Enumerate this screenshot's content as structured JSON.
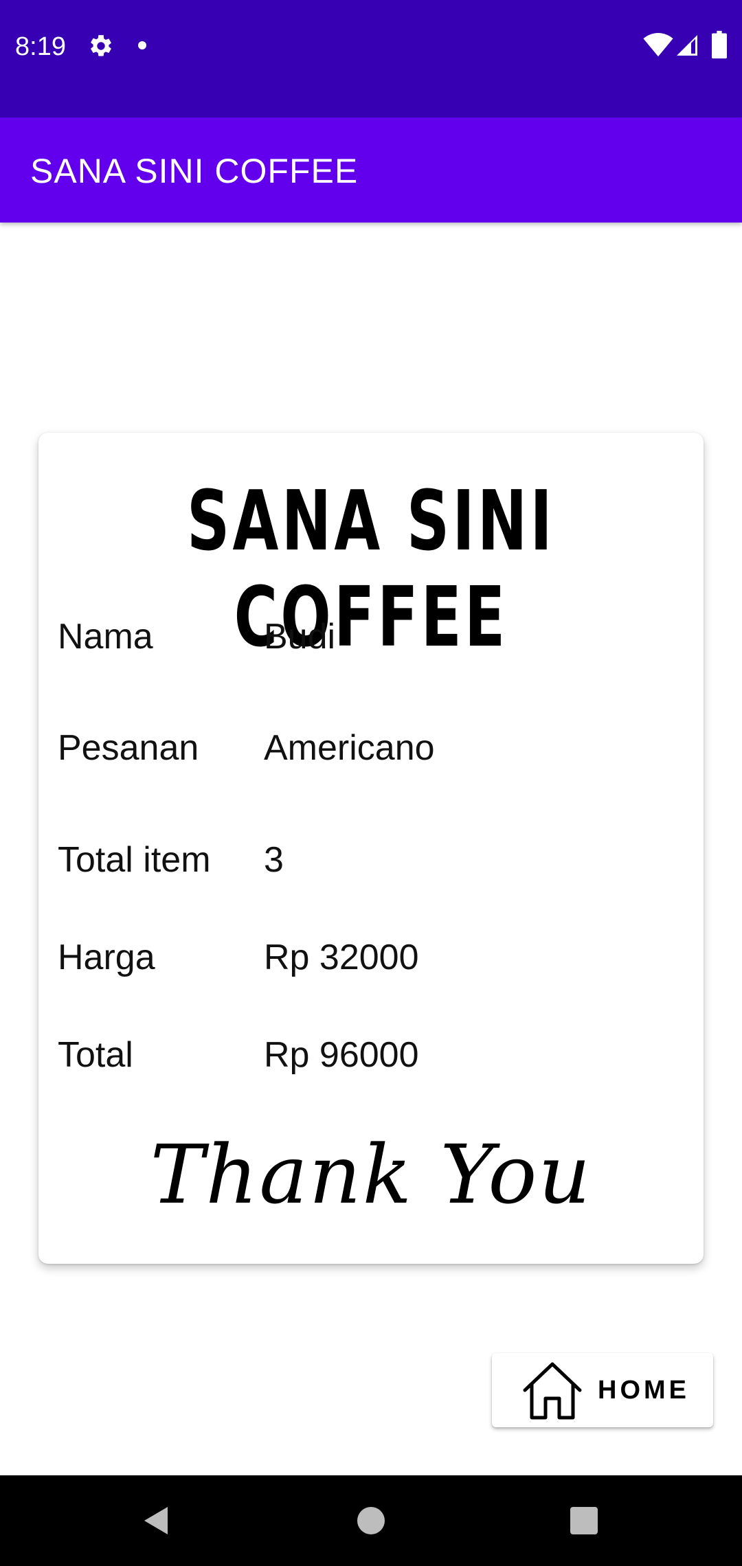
{
  "status_bar": {
    "time": "8:19",
    "icons": [
      "settings-icon",
      "notification-dot-icon",
      "wifi-icon",
      "signal-icon",
      "battery-icon"
    ]
  },
  "app_bar": {
    "title": "SANA SINI COFFEE"
  },
  "receipt": {
    "heading": "SANA SINI COFFEE",
    "rows": [
      {
        "label": "Nama",
        "value": "Budi"
      },
      {
        "label": "Pesanan",
        "value": "Americano"
      },
      {
        "label": "Total item",
        "value": "3"
      },
      {
        "label": "Harga",
        "value": "Rp 32000"
      },
      {
        "label": "Total",
        "value": "Rp 96000"
      }
    ],
    "footer": "Thank You"
  },
  "home_button": {
    "label": "HOME",
    "icon": "home-icon"
  },
  "nav_bar": {
    "icons": [
      "back-icon",
      "home-circle-icon",
      "recents-icon"
    ]
  },
  "colors": {
    "status_bar": "#3700B3",
    "app_bar": "#6200EE",
    "nav_bar": "#000000"
  }
}
